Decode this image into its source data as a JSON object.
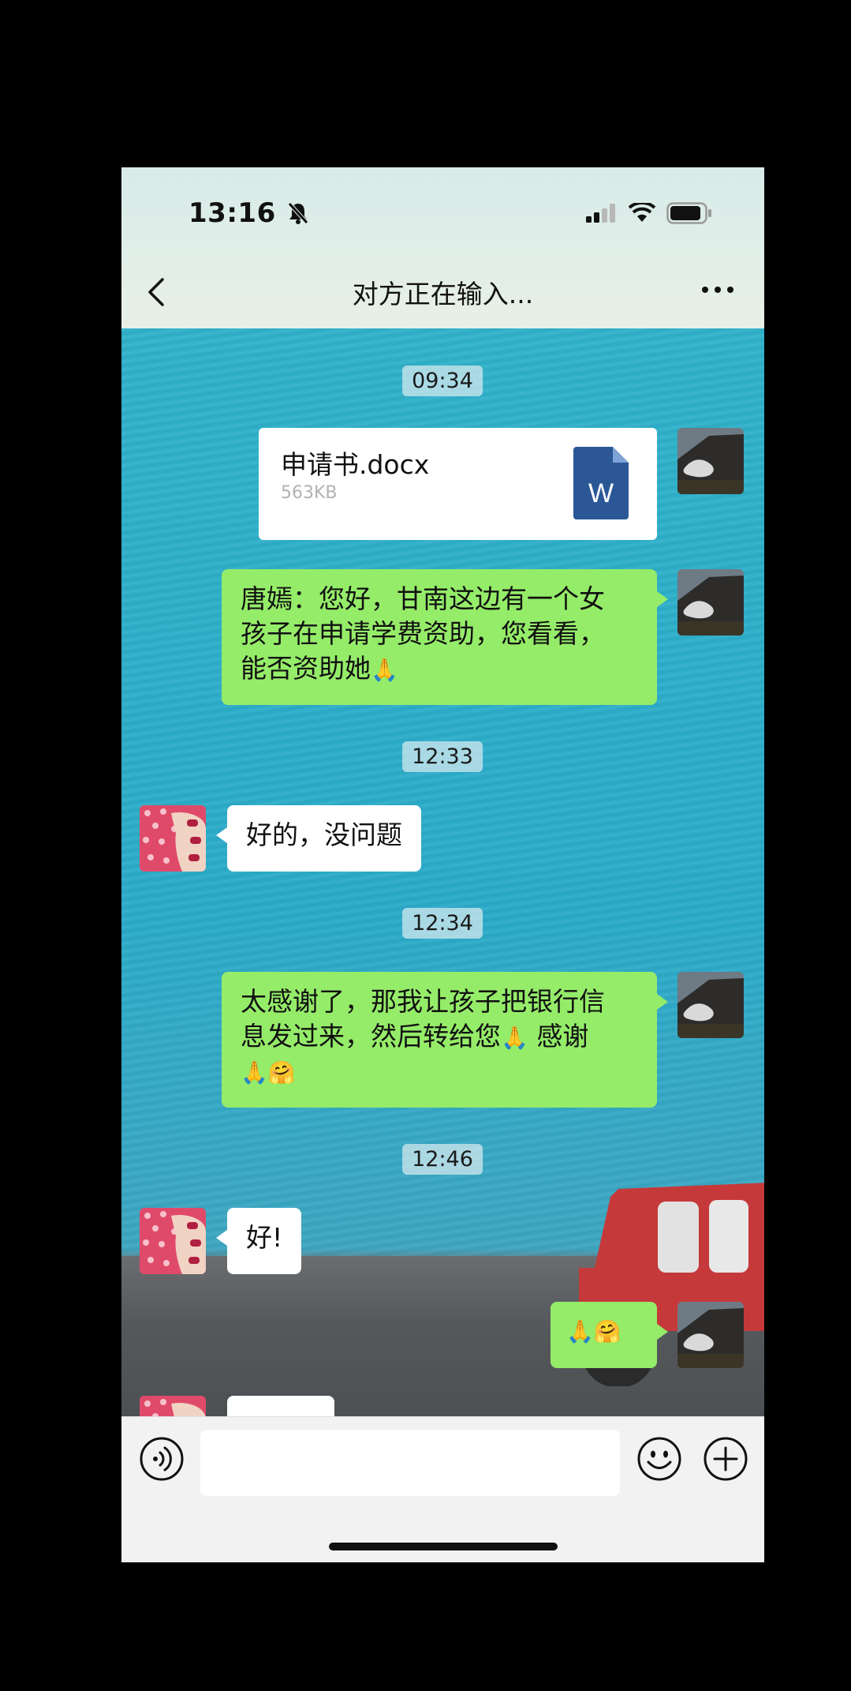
{
  "status_bar": {
    "time": "13:16",
    "icons": [
      "bell-slash-icon",
      "cellular-signal-icon",
      "wifi-icon",
      "battery-icon"
    ]
  },
  "nav": {
    "title": "对方正在输入...",
    "back_icon": "chevron-left-icon",
    "more_icon": "ellipsis-icon"
  },
  "messages": [
    {
      "type": "timestamp",
      "text": "09:34"
    },
    {
      "type": "file",
      "side": "right",
      "file_name": "申请书.docx",
      "file_size": "563KB",
      "file_icon": "word-document-icon"
    },
    {
      "type": "text",
      "side": "right",
      "lines": [
        "唐嫣：您好，甘南这边有一个女",
        "孩子在申请学费资助，您看看，",
        "能否资助她"
      ],
      "emoji": "🙏"
    },
    {
      "type": "timestamp",
      "text": "12:33"
    },
    {
      "type": "text",
      "side": "left",
      "text": "好的，没问题"
    },
    {
      "type": "timestamp",
      "text": "12:34"
    },
    {
      "type": "text",
      "side": "right",
      "lines": [
        "太感谢了，那我让孩子把银行信",
        "息发过来，然后转给您"
      ],
      "line2_suffix": "感谢",
      "emoji_mid": "🙏",
      "emoji_end": "🙏🤗"
    },
    {
      "type": "timestamp",
      "text": "12:46"
    },
    {
      "type": "text",
      "side": "left",
      "text": "好!"
    },
    {
      "type": "emoji",
      "side": "right",
      "text": "🙏🤗"
    }
  ],
  "input_bar": {
    "voice_icon": "voice-input-icon",
    "input_value": "",
    "emoji_icon": "smiley-icon",
    "plus_icon": "plus-circle-icon"
  },
  "colors": {
    "bubble_sent": "#95ec69",
    "bubble_received": "#ffffff",
    "chat_background": "#2fb1c9"
  }
}
